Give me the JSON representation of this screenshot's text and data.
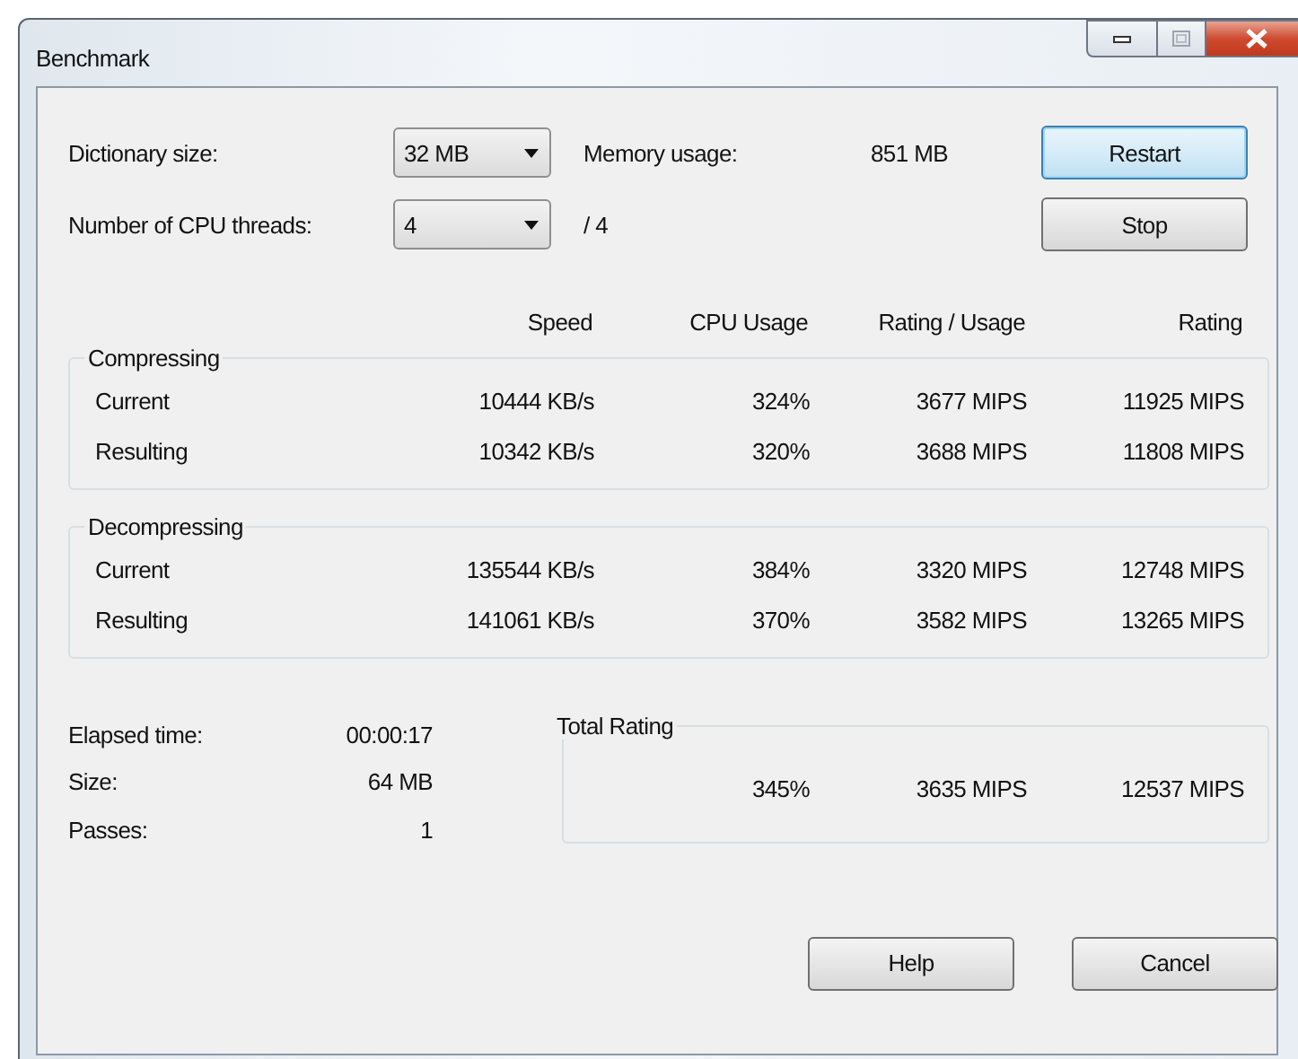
{
  "window": {
    "title": "Benchmark"
  },
  "settings": [
    {
      "label": "Dictionary size:",
      "value": "32 MB",
      "info_label": "Memory usage:",
      "info_value": "851 MB"
    },
    {
      "label": "Number of CPU threads:",
      "value": "4",
      "info_label": "/ 4"
    }
  ],
  "side_buttons": [
    {
      "label": "Restart",
      "focused": true
    },
    {
      "label": "Stop",
      "focused": false
    }
  ],
  "table": {
    "columns": [
      "Speed",
      "CPU Usage",
      "Rating / Usage",
      "Rating"
    ],
    "groups": [
      {
        "title": "Compressing",
        "rows": [
          {
            "label": "Current",
            "cells": [
              "10444 KB/s",
              "324%",
              "3677 MIPS",
              "11925 MIPS"
            ]
          },
          {
            "label": "Resulting",
            "cells": [
              "10342 KB/s",
              "320%",
              "3688 MIPS",
              "11808 MIPS"
            ]
          }
        ]
      },
      {
        "title": "Decompressing",
        "rows": [
          {
            "label": "Current",
            "cells": [
              "135544 KB/s",
              "384%",
              "3320 MIPS",
              "12748 MIPS"
            ]
          },
          {
            "label": "Resulting",
            "cells": [
              "141061 KB/s",
              "370%",
              "3582 MIPS",
              "13265 MIPS"
            ]
          }
        ]
      }
    ]
  },
  "summary": [
    {
      "label": "Elapsed time:",
      "value": "00:00:17"
    },
    {
      "label": "Size:",
      "value": "64 MB"
    },
    {
      "label": "Passes:",
      "value": "1"
    }
  ],
  "total_rating": {
    "title": "Total Rating",
    "cells": [
      "345%",
      "3635 MIPS",
      "12537 MIPS"
    ]
  },
  "bottom_buttons": [
    {
      "label": "Help",
      "focused": false
    },
    {
      "label": "Cancel",
      "focused": false
    }
  ]
}
